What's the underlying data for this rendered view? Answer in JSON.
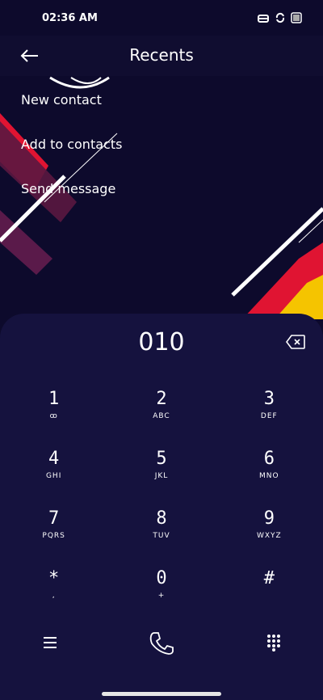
{
  "status": {
    "time": "02:36 AM"
  },
  "header": {
    "title": "Recents"
  },
  "menu": [
    {
      "label": "New contact"
    },
    {
      "label": "Add to contacts"
    },
    {
      "label": "Send message"
    }
  ],
  "dialer": {
    "number": "010",
    "keys": [
      {
        "digit": "1",
        "letters": "ꝏ"
      },
      {
        "digit": "2",
        "letters": "ABC"
      },
      {
        "digit": "3",
        "letters": "DEF"
      },
      {
        "digit": "4",
        "letters": "GHI"
      },
      {
        "digit": "5",
        "letters": "JKL"
      },
      {
        "digit": "6",
        "letters": "MNO"
      },
      {
        "digit": "7",
        "letters": "PQRS"
      },
      {
        "digit": "8",
        "letters": "TUV"
      },
      {
        "digit": "9",
        "letters": "WXYZ"
      },
      {
        "digit": "*",
        "letters": ","
      },
      {
        "digit": "0",
        "letters": "+"
      },
      {
        "digit": "#",
        "letters": ""
      }
    ]
  },
  "colors": {
    "background": "#0d0a2c",
    "pad": "#15123e",
    "accent_red": "#e01432",
    "accent_yellow": "#f5c400"
  },
  "icons": [
    "back-arrow-icon",
    "backspace-icon",
    "menu-icon",
    "call-icon",
    "dialpad-icon"
  ]
}
